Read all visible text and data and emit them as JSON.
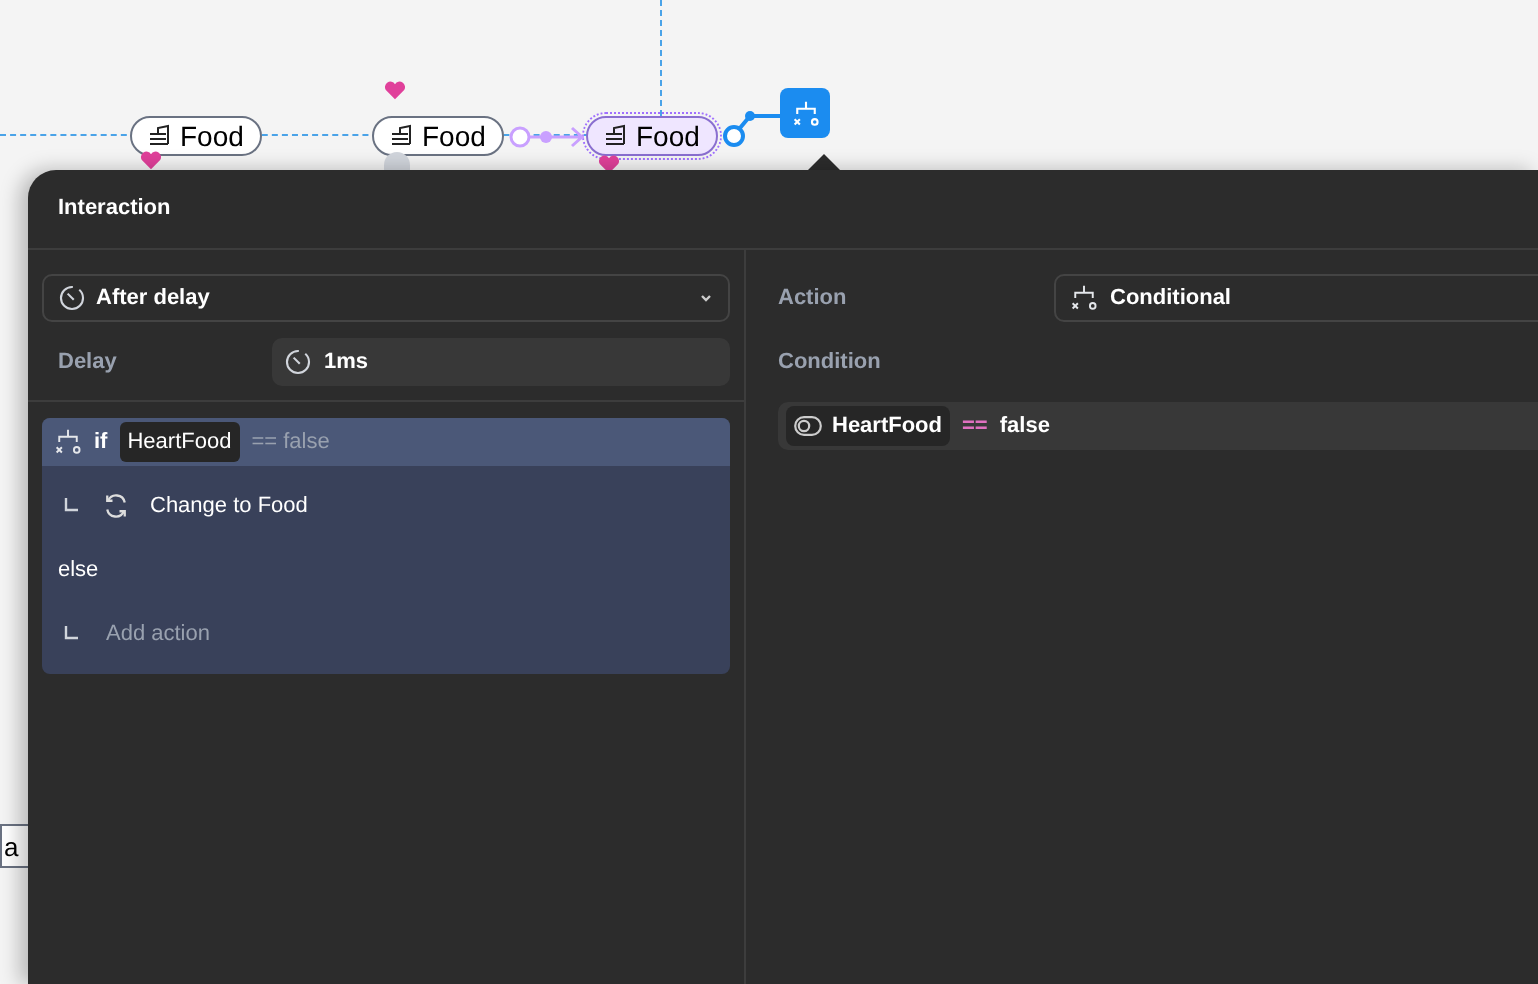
{
  "canvas": {
    "nodes": [
      {
        "label": "Food",
        "selected": false
      },
      {
        "label": "Food",
        "selected": false
      },
      {
        "label": "Food",
        "selected": true
      }
    ],
    "cut_label": "a"
  },
  "panel": {
    "title": "Interaction",
    "trigger": {
      "value": "After delay"
    },
    "delay": {
      "label": "Delay",
      "value": "1ms"
    },
    "conditional": {
      "keyword": "if",
      "variable": "HeartFood",
      "comparison": "== false",
      "then_actions": [
        "Change to Food"
      ],
      "else_keyword": "else",
      "else_placeholder": "Add action"
    },
    "action": {
      "label": "Action",
      "value": "Conditional"
    },
    "condition": {
      "label": "Condition",
      "variable": "HeartFood",
      "operator": "==",
      "value": "false"
    }
  }
}
